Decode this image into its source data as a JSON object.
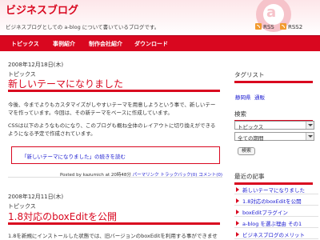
{
  "header": {
    "site_title": "ビジネスブログ",
    "description": "ビジネスブログとしての a-blog について書いているブログです。",
    "rss_label": "RSS",
    "rss2_label": "RSS2",
    "logo_letter": "a"
  },
  "nav": {
    "items": [
      "トピックス",
      "事例紹介",
      "制作会社紹介",
      "ダウンロード"
    ]
  },
  "entries": [
    {
      "date": "2008年12月18日(木)",
      "category": "トピックス",
      "title": "新しいテーマになりました",
      "paragraphs": [
        "今後、今までよりもカスタマイズがしやすいテーマを用意しようという事で、新しいテーマを作っています。今回は、その新テーマをベースに作成しています。",
        "CSSは以下のようなものになり、このブログも概ね全体のレイアウトに切り換えができるようになる予定で作成されています。"
      ],
      "more_link_title": "「新しいテーマになりました」",
      "more_link_rest": "の続きを読む",
      "footer": {
        "prefix": "Posted by kazumich at 20時48分",
        "permalink": "パーマリンク",
        "trackback": "トラックバック(0)",
        "comments": "コメント(0)"
      }
    },
    {
      "date": "2008年12月11日(木)",
      "category": "トピックス",
      "title": "1.8対応のboxEditを公開",
      "paragraphs": [
        "1.8を新規にインストールした状態では、旧バージョンのboxEditを利用する事ができません。"
      ]
    }
  ],
  "sidebar": {
    "tag_heading": "タグリスト",
    "tags": [
      "静岡県",
      "通販"
    ],
    "search_heading": "検索",
    "category_select": "トピックス",
    "period_select": "全ての期間",
    "search_button": "検索",
    "recent_heading": "最近の記事",
    "recent_items": [
      "新しいテーマになりました",
      "1.8対応のboxEditを公開",
      "boxEditプラグイン",
      "a-blog を選ぶ理由 その1",
      "ビジネスブログのメリット"
    ]
  }
}
